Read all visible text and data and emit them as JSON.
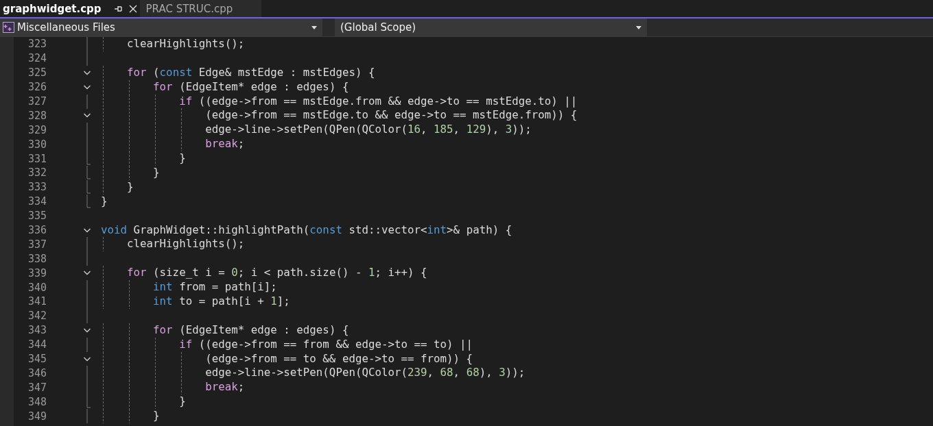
{
  "tabs": [
    {
      "label": "graphwidget.cpp",
      "selected": true
    },
    {
      "label": "PRAC STRUC.cpp",
      "selected": false
    }
  ],
  "navigation": {
    "project": "Miscellaneous Files",
    "scope": "(Global Scope)"
  },
  "editor": {
    "lines": [
      {
        "number": "323",
        "kind": "bar",
        "code": [
          {
            "kind": "plain",
            "text": "    clearHighlights();"
          }
        ]
      },
      {
        "number": "324",
        "kind": "bar"
      },
      {
        "number": "325",
        "kind": "fold",
        "code": [
          {
            "kind": "control",
            "text": "    for"
          },
          {
            "kind": "plain",
            "text": " ("
          },
          {
            "kind": "keyword",
            "text": "const"
          },
          {
            "kind": "plain",
            "text": " Edge& mstEdge : mstEdges) {"
          }
        ]
      },
      {
        "number": "326",
        "kind": "fold",
        "code": [
          {
            "kind": "control",
            "text": "        for"
          },
          {
            "kind": "plain",
            "text": " (EdgeItem* edge : edges) {"
          }
        ]
      },
      {
        "number": "327",
        "kind": "bar",
        "code": [
          {
            "kind": "control",
            "text": "            if"
          },
          {
            "kind": "plain",
            "text": " ((edge->from == mstEdge.from && edge->to == mstEdge.to) ||"
          }
        ]
      },
      {
        "number": "328",
        "kind": "fold",
        "code": [
          {
            "kind": "plain",
            "text": "                (edge->from == mstEdge.to && edge->to == mstEdge.from)) {"
          }
        ]
      },
      {
        "number": "329",
        "kind": "bar",
        "code": [
          {
            "kind": "plain",
            "text": "                edge->line->setPen(QPen(QColor("
          },
          {
            "kind": "number",
            "text": "16"
          },
          {
            "kind": "plain",
            "text": ", "
          },
          {
            "kind": "number",
            "text": "185"
          },
          {
            "kind": "plain",
            "text": ", "
          },
          {
            "kind": "number",
            "text": "129"
          },
          {
            "kind": "plain",
            "text": "), "
          },
          {
            "kind": "number",
            "text": "3"
          },
          {
            "kind": "plain",
            "text": "));"
          }
        ]
      },
      {
        "number": "330",
        "kind": "bar",
        "code": [
          {
            "kind": "control",
            "text": "                break"
          },
          {
            "kind": "plain",
            "text": ";"
          }
        ]
      },
      {
        "number": "331",
        "kind": "end",
        "code": [
          {
            "kind": "plain",
            "text": "            }"
          }
        ]
      },
      {
        "number": "332",
        "kind": "end",
        "code": [
          {
            "kind": "plain",
            "text": "        }"
          }
        ]
      },
      {
        "number": "333",
        "kind": "end",
        "code": [
          {
            "kind": "plain",
            "text": "    }"
          }
        ]
      },
      {
        "number": "334",
        "kind": "end",
        "code": [
          {
            "kind": "plain",
            "text": "}"
          }
        ]
      },
      {
        "number": "335",
        "kind": "blank"
      },
      {
        "number": "336",
        "kind": "fold",
        "code": [
          {
            "kind": "keyword",
            "text": "void"
          },
          {
            "kind": "plain",
            "text": " GraphWidget::highlightPath("
          },
          {
            "kind": "keyword",
            "text": "const"
          },
          {
            "kind": "plain",
            "text": " std::vector<"
          },
          {
            "kind": "keyword",
            "text": "int"
          },
          {
            "kind": "plain",
            "text": ">& path) {"
          }
        ]
      },
      {
        "number": "337",
        "kind": "bar",
        "code": [
          {
            "kind": "plain",
            "text": "    clearHighlights();"
          }
        ]
      },
      {
        "number": "338",
        "kind": "bar"
      },
      {
        "number": "339",
        "kind": "fold",
        "code": [
          {
            "kind": "control",
            "text": "    for"
          },
          {
            "kind": "plain",
            "text": " (size_t i = "
          },
          {
            "kind": "number",
            "text": "0"
          },
          {
            "kind": "plain",
            "text": "; i < path.size() - "
          },
          {
            "kind": "number",
            "text": "1"
          },
          {
            "kind": "plain",
            "text": "; i++) {"
          }
        ]
      },
      {
        "number": "340",
        "kind": "bar",
        "code": [
          {
            "kind": "keyword",
            "text": "        int"
          },
          {
            "kind": "plain",
            "text": " from = path[i];"
          }
        ]
      },
      {
        "number": "341",
        "kind": "bar",
        "code": [
          {
            "kind": "keyword",
            "text": "        int"
          },
          {
            "kind": "plain",
            "text": " to = path[i + "
          },
          {
            "kind": "number",
            "text": "1"
          },
          {
            "kind": "plain",
            "text": "];"
          }
        ]
      },
      {
        "number": "342",
        "kind": "bar"
      },
      {
        "number": "343",
        "kind": "fold",
        "code": [
          {
            "kind": "control",
            "text": "        for"
          },
          {
            "kind": "plain",
            "text": " (EdgeItem* edge : edges) {"
          }
        ]
      },
      {
        "number": "344",
        "kind": "bar",
        "code": [
          {
            "kind": "control",
            "text": "            if"
          },
          {
            "kind": "plain",
            "text": " ((edge->from == from && edge->to == to) ||"
          }
        ]
      },
      {
        "number": "345",
        "kind": "fold",
        "code": [
          {
            "kind": "plain",
            "text": "                (edge->from == to && edge->to == from)) {"
          }
        ]
      },
      {
        "number": "346",
        "kind": "bar",
        "code": [
          {
            "kind": "plain",
            "text": "                edge->line->setPen(QPen(QColor("
          },
          {
            "kind": "number",
            "text": "239"
          },
          {
            "kind": "plain",
            "text": ", "
          },
          {
            "kind": "number",
            "text": "68"
          },
          {
            "kind": "plain",
            "text": ", "
          },
          {
            "kind": "number",
            "text": "68"
          },
          {
            "kind": "plain",
            "text": "), "
          },
          {
            "kind": "number",
            "text": "3"
          },
          {
            "kind": "plain",
            "text": "));"
          }
        ]
      },
      {
        "number": "347",
        "kind": "bar",
        "code": [
          {
            "kind": "control",
            "text": "                break"
          },
          {
            "kind": "plain",
            "text": ";"
          }
        ]
      },
      {
        "number": "348",
        "kind": "end",
        "code": [
          {
            "kind": "plain",
            "text": "            }"
          }
        ]
      },
      {
        "number": "349",
        "kind": "bar",
        "code": [
          {
            "kind": "plain",
            "text": "        }"
          }
        ]
      }
    ]
  }
}
